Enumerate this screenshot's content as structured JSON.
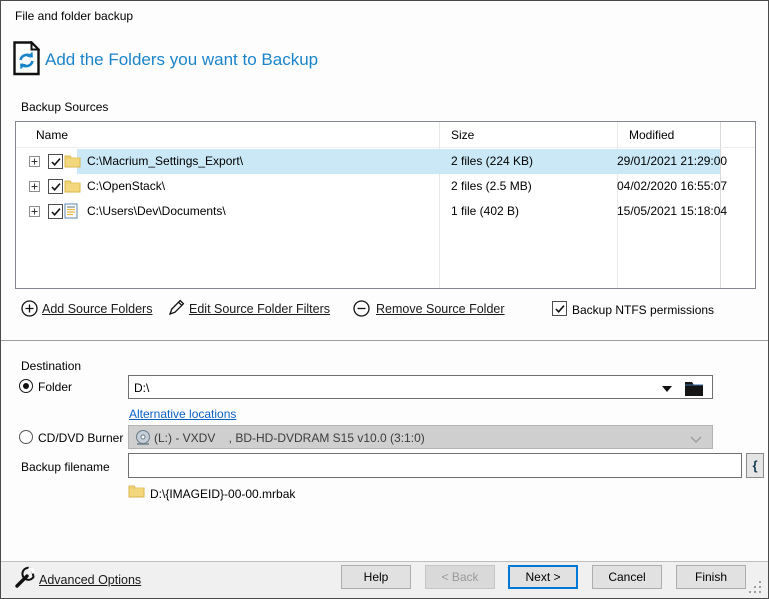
{
  "window": {
    "title": "File and folder backup"
  },
  "header": {
    "title": "Add the Folders you want to Backup",
    "accent_color": "#1b84c9"
  },
  "sources": {
    "label": "Backup Sources",
    "columns": [
      "Name",
      "Size",
      "Modified"
    ],
    "rows": [
      {
        "name": "C:\\Macrium_Settings_Export\\",
        "size": "2 files (224 KB)",
        "modified": "29/01/2021 21:29:00",
        "checked": true,
        "selected": true,
        "icon": "folder-icon"
      },
      {
        "name": "C:\\OpenStack\\",
        "size": "2 files (2.5 MB)",
        "modified": "04/02/2020 16:55:07",
        "checked": true,
        "selected": false,
        "icon": "folder-icon"
      },
      {
        "name": "C:\\Users\\Dev\\Documents\\",
        "size": "1 file (402 B)",
        "modified": "15/05/2021 15:18:04",
        "checked": true,
        "selected": false,
        "icon": "documents-icon"
      }
    ],
    "selection_color": "#cbe8f6",
    "actions": {
      "add": "Add Source Folders",
      "edit": "Edit Source Folder Filters",
      "remove": "Remove Source Folder"
    },
    "ntfs_label": "Backup NTFS permissions",
    "ntfs_checked": true
  },
  "destination": {
    "label": "Destination",
    "folder_radio_label": "Folder",
    "folder_selected": true,
    "folder_value": "D:\\",
    "alternative_link": "Alternative locations",
    "cd_radio_label": "CD/DVD Burner",
    "cd_selected": false,
    "cd_value": "(L:) - VXDV    , BD-HD-DVDRAM S15 v10.0 (3:1:0)",
    "filename_label": "Backup filename",
    "filename_value": "",
    "insert_button": "{",
    "path_preview": "D:\\{IMAGEID}-00-00.mrbak"
  },
  "footer": {
    "advanced_link": "Advanced Options",
    "buttons": {
      "help": "Help",
      "back": "< Back",
      "next": "Next >",
      "cancel": "Cancel",
      "finish": "Finish"
    },
    "back_enabled": false,
    "default_button": "next",
    "default_border_color": "#0078d7"
  }
}
